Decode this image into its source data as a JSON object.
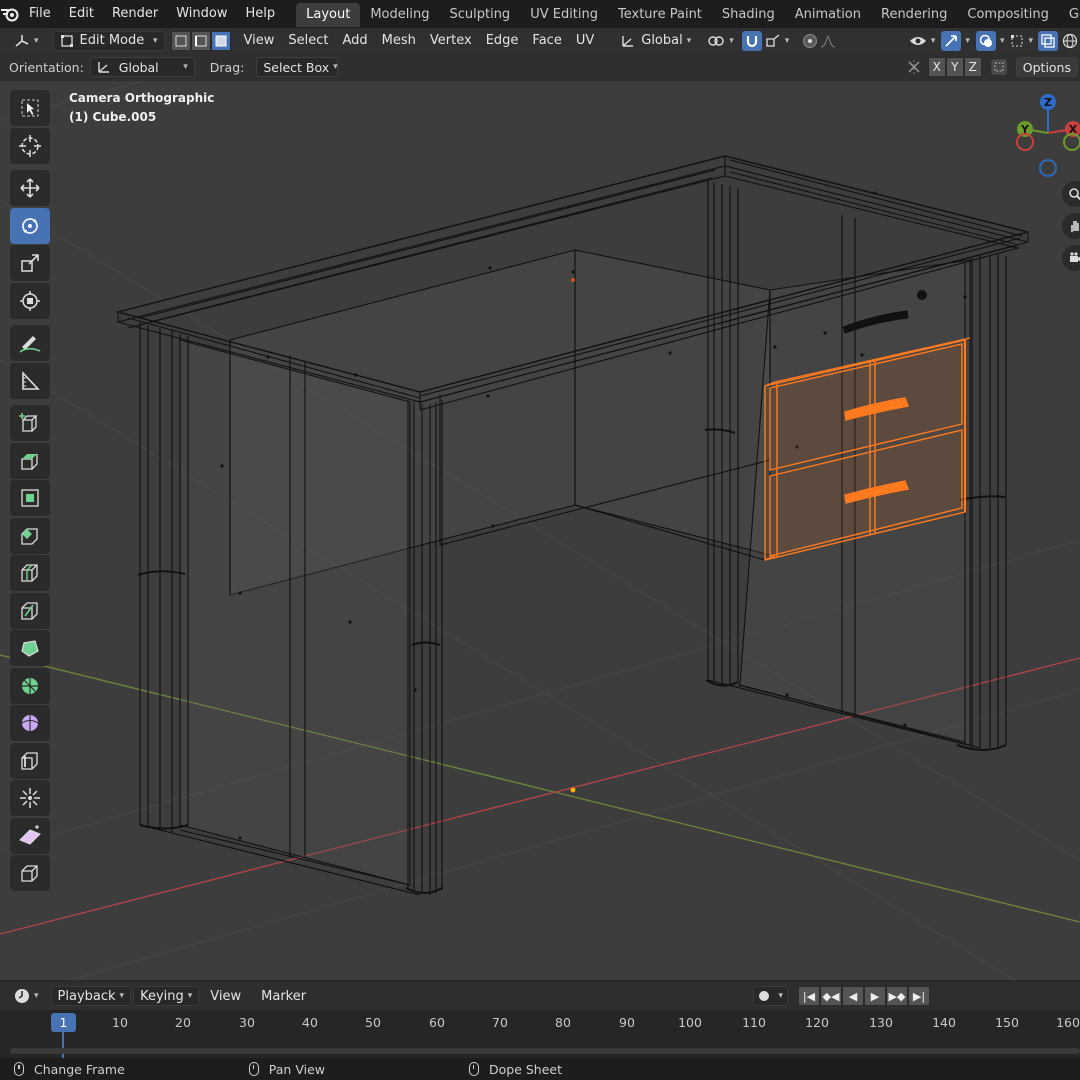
{
  "menubar": {
    "items": [
      "File",
      "Edit",
      "Render",
      "Window",
      "Help"
    ],
    "workspaces": [
      "Layout",
      "Modeling",
      "Sculpting",
      "UV Editing",
      "Texture Paint",
      "Shading",
      "Animation",
      "Rendering",
      "Compositing",
      "Geometry Nodes"
    ],
    "active_workspace": "Layout"
  },
  "header3d": {
    "mode": "Edit Mode",
    "menus": [
      "View",
      "Select",
      "Add",
      "Mesh",
      "Vertex",
      "Edge",
      "Face",
      "UV"
    ],
    "transform_orientation": "Global"
  },
  "toolsettings": {
    "orientation_label": "Orientation:",
    "orientation_value": "Global",
    "drag_label": "Drag:",
    "drag_value": "Select Box",
    "axes": [
      "X",
      "Y",
      "Z"
    ],
    "options_label": "Options"
  },
  "viewport": {
    "view_name": "Camera Orthographic",
    "object_name": "(1) Cube.005",
    "gizmo_labels": [
      "Z",
      "Y",
      "X"
    ]
  },
  "toolbar": {
    "tools": [
      "select-box-icon",
      "cursor-icon",
      "move-icon",
      "rotate-icon",
      "scale-icon",
      "transform-icon",
      "annotate-icon",
      "measure-icon",
      "add-cube-icon",
      "extrude-icon",
      "inset-icon",
      "bevel-icon",
      "loop-cut-icon",
      "knife-icon",
      "poly-build-icon",
      "spin-icon",
      "smooth-icon",
      "edge-slide-icon",
      "shrink-fatten-icon",
      "shear-icon",
      "rip-icon"
    ],
    "active_tool": "rotate-icon"
  },
  "timeline": {
    "menus": [
      "Playback",
      "Keying",
      "View",
      "Marker"
    ],
    "current_frame": "1",
    "ticks": [
      "10",
      "20",
      "30",
      "40",
      "50",
      "60",
      "70",
      "80",
      "90",
      "100",
      "110",
      "120",
      "130",
      "140",
      "150",
      "160"
    ]
  },
  "statusbar": {
    "items": [
      "Change Frame",
      "Pan View",
      "Dope Sheet"
    ]
  },
  "colors": {
    "selection": "#ff7a1f",
    "active_blue": "#4772b3",
    "viewport_bg": "#3d3d3d",
    "x_axis": "#c94a4a",
    "y_axis": "#7a9c3a"
  }
}
